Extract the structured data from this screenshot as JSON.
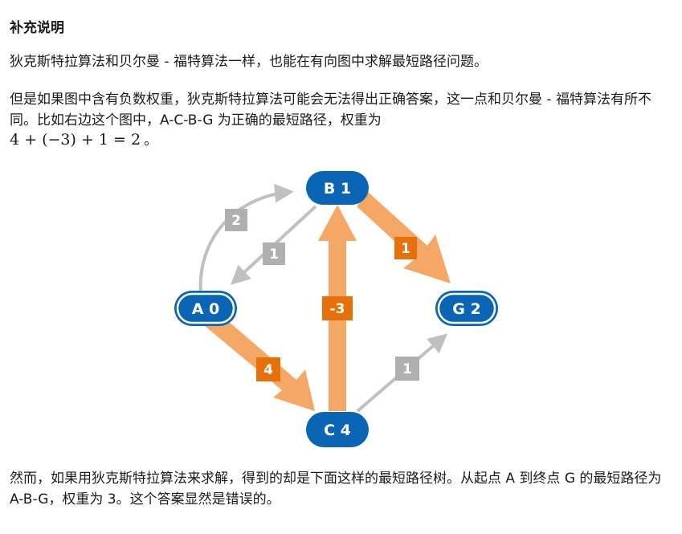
{
  "heading": "补充说明",
  "paragraphs": {
    "p1": "狄克斯特拉算法和贝尔曼 - 福特算法一样，也能在有向图中求解最短路径问题。",
    "p2": "但是如果图中含有负数权重，狄克斯特拉算法可能会无法得出正确答案，这一点和贝尔曼 - 福特算法有所不同。比如右边这个图中，A-C-B-G 为正确的最短路径，权重为",
    "formula": "4 + (−3) + 1 = 2",
    "formula_tail": "。",
    "p3": "然而，如果用狄克斯特拉算法来求解，得到的却是下面这样的最短路径树。从起点 A 到终点 G 的最短路径为 A-B-G，权重为 3。这个答案显然是错误的。"
  },
  "graph": {
    "colors": {
      "node": "#0a66b4",
      "highlight_edge": "#f5a866",
      "highlight_label": "#e8700a",
      "plain_edge": "#c0c0c0",
      "plain_label": "#b0b0b0"
    },
    "nodes": {
      "A": "A 0",
      "B": "B 1",
      "C": "C 4",
      "G": "G 2"
    },
    "edge_weights": {
      "A_B": "2",
      "B_A": "1",
      "B_G": "1",
      "A_C": "4",
      "C_B": "-3",
      "C_G": "1"
    }
  }
}
